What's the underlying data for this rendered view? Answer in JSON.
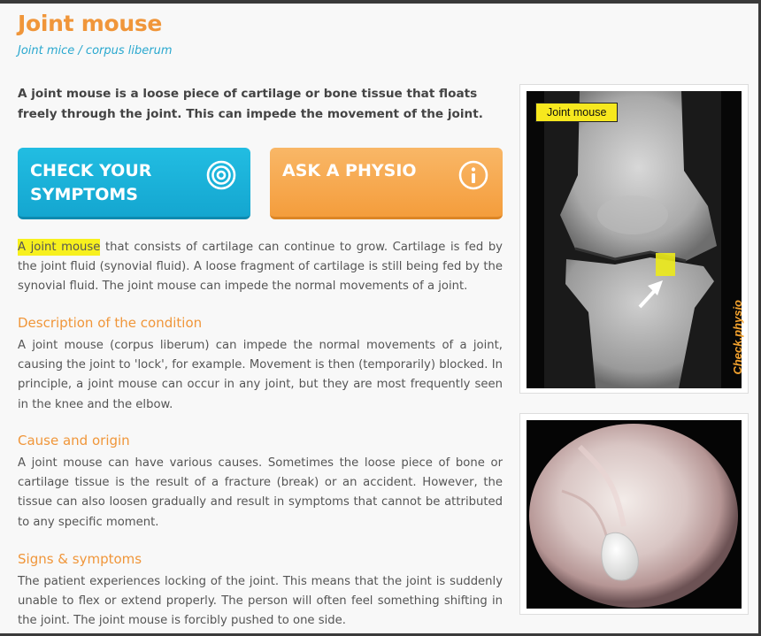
{
  "page": {
    "title": "Joint mouse",
    "subtitle": "Joint mice / corpus liberum",
    "intro": "A joint mouse is a loose piece of cartilage or bone tissue that floats freely through the joint. This can impede the movement of the joint."
  },
  "cta": {
    "symptoms_label": "CHECK YOUR SYMPTOMS",
    "physio_label": "ASK A PHYSIO",
    "symptoms_icon": "target-icon",
    "physio_icon": "info-icon",
    "symptoms_color": "#1bb4dc",
    "physio_color": "#f6a94c"
  },
  "body": {
    "highlight_term": "A joint mouse",
    "para1_rest": " that consists of cartilage can continue to grow. Cartilage is fed by the joint fluid (synovial fluid). A loose fragment of cartilage is still being fed by the synovial fluid. The joint mouse can impede the normal movements of a joint."
  },
  "sections": [
    {
      "heading": "Description of the condition",
      "text": "A joint mouse (corpus liberum) can impede the normal movements of a joint, causing the joint to 'lock', for example. Movement is then (temporarily) blocked. In principle, a joint mouse can occur in any joint, but they are most frequently seen in the knee and the elbow."
    },
    {
      "heading": "Cause and origin",
      "text": "A joint mouse can have various causes. Sometimes the loose piece of bone or cartilage tissue is the result of a fracture (break) or an accident. However, the tissue can also loosen gradually and result in symptoms that cannot be attributed to any specific moment."
    },
    {
      "heading": "Signs & symptoms",
      "text": "The patient experiences locking of the joint. This means that the joint is suddenly unable to flex or extend properly. The person will often feel something shifting in the joint. The joint mouse is forcibly pushed to one side."
    }
  ],
  "images": {
    "xray_label": "Joint mouse",
    "watermark": "Check.physio"
  },
  "colors": {
    "heading": "#f0963a",
    "subtitle": "#2aa8cf",
    "highlight": "#f7f01e"
  }
}
